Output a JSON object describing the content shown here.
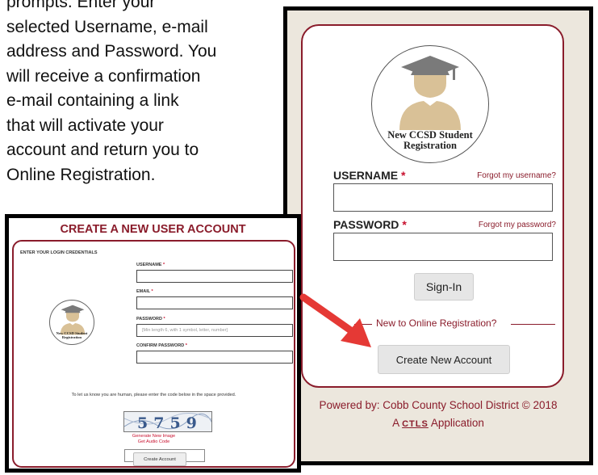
{
  "intro": {
    "lines": [
      "prompts. Enter your",
      "selected Username, e-mail",
      "address and Password. You",
      "will receive a confirmation",
      "e-mail containing a link",
      "that will activate your",
      "account and return you to",
      "Online Registration."
    ]
  },
  "login": {
    "logo_line1": "New CCSD Student",
    "logo_line2": "Registration",
    "username_label": "USERNAME",
    "password_label": "PASSWORD",
    "required_mark": "*",
    "forgot_username": "Forgot my username?",
    "forgot_password": "Forgot my password?",
    "signin_label": "Sign-In",
    "new_to": "New to Online Registration?",
    "create_label": "Create New Account",
    "powered_by": "Powered by: Cobb County School District © 2018",
    "app_prefix": "A",
    "ctls": "CTLS",
    "app_suffix": "Application"
  },
  "create": {
    "title": "CREATE A NEW USER ACCOUNT",
    "section_heading": "ENTER YOUR LOGIN CREDENTIALS",
    "logo_line1": "New CCSD Student",
    "logo_line2": "Registration",
    "username_label": "USERNAME",
    "email_label": "EMAIL",
    "password_label": "PASSWORD",
    "password_placeholder": "[Min length 6, with 1 symbol, letter, number]",
    "confirm_label": "CONFIRM PASSWORD",
    "required_mark": "*",
    "human_text": "To let us know you are human, please enter the code below in the space provided.",
    "captcha_code": "5759",
    "generate_link": "Generate New Image",
    "audio_link": "Get Audio Code",
    "submit_label": "Create Account"
  },
  "colors": {
    "brand": "#8a1c2b",
    "required": "#c8102e",
    "frame_bg": "#ece7dd",
    "arrow": "#e53935"
  },
  "icons": {
    "logo": "graduate-icon",
    "pointer": "arrow-icon"
  }
}
